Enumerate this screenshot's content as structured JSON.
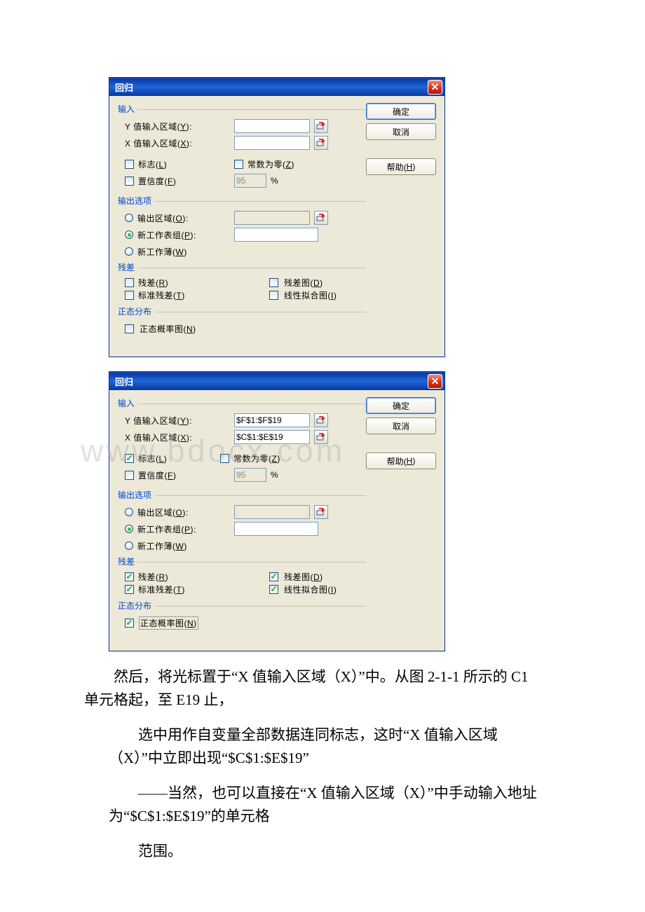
{
  "watermark": "www.bdocx.com",
  "dialogs": [
    {
      "title": "回归",
      "buttons": {
        "ok": "确定",
        "cancel": "取消",
        "help": "帮助(H)",
        "help_accel": "H"
      },
      "input": {
        "legend": "输入",
        "y_label": "Y 值输入区域(Y):",
        "y_accel": "Y",
        "y_value": "",
        "x_label": "X 值输入区域(X):",
        "x_accel": "X",
        "x_value": "",
        "labels_cb": "标志(L)",
        "labels_accel": "L",
        "labels_checked": false,
        "zero_cb": "常数为零(Z)",
        "zero_accel": "Z",
        "zero_checked": false,
        "conf_cb": "置信度(F)",
        "conf_accel": "F",
        "conf_checked": false,
        "conf_value": "95",
        "pct": "%"
      },
      "output": {
        "legend": "输出选项",
        "out_range": "输出区域(O):",
        "out_accel": "O",
        "out_selected": false,
        "out_value": "",
        "new_sheet": "新工作表组(P):",
        "new_sheet_accel": "P",
        "new_sheet_selected": true,
        "new_sheet_value": "",
        "new_book": "新工作薄(W)",
        "new_book_accel": "W",
        "new_book_selected": false,
        "resid_legend": "残差",
        "resid_cb": "残差(R)",
        "resid_accel": "R",
        "resid_checked": false,
        "residplot_cb": "残差图(D)",
        "residplot_accel": "D",
        "residplot_checked": false,
        "stdresid_cb": "标准残差(T)",
        "stdresid_accel": "T",
        "stdresid_checked": false,
        "linefit_cb": "线性拟合图(I)",
        "linefit_accel": "I",
        "linefit_checked": false,
        "norm_legend": "正态分布",
        "normprob_cb": "正态概率图(N)",
        "normprob_accel": "N",
        "normprob_checked": false
      }
    },
    {
      "title": "回归",
      "buttons": {
        "ok": "确定",
        "cancel": "取消",
        "help": "帮助(H)",
        "help_accel": "H"
      },
      "input": {
        "legend": "输入",
        "y_label": "Y 值输入区域(Y):",
        "y_accel": "Y",
        "y_value": "$F$1:$F$19",
        "x_label": "X 值输入区域(X):",
        "x_accel": "X",
        "x_value": "$C$1:$E$19",
        "labels_cb": "标志(L)",
        "labels_accel": "L",
        "labels_checked": true,
        "zero_cb": "常数为零(Z)",
        "zero_accel": "Z",
        "zero_checked": false,
        "conf_cb": "置信度(F)",
        "conf_accel": "F",
        "conf_checked": false,
        "conf_value": "95",
        "pct": "%"
      },
      "output": {
        "legend": "输出选项",
        "out_range": "输出区域(O):",
        "out_accel": "O",
        "out_selected": false,
        "out_value": "",
        "new_sheet": "新工作表组(P):",
        "new_sheet_accel": "P",
        "new_sheet_selected": true,
        "new_sheet_value": "",
        "new_book": "新工作薄(W)",
        "new_book_accel": "W",
        "new_book_selected": false,
        "resid_legend": "残差",
        "resid_cb": "残差(R)",
        "resid_accel": "R",
        "resid_checked": true,
        "residplot_cb": "残差图(D)",
        "residplot_accel": "D",
        "residplot_checked": true,
        "stdresid_cb": "标准残差(T)",
        "stdresid_accel": "T",
        "stdresid_checked": true,
        "linefit_cb": "线性拟合图(I)",
        "linefit_accel": "I",
        "linefit_checked": true,
        "norm_legend": "正态分布",
        "normprob_cb": "正态概率图(N)",
        "normprob_accel": "N",
        "normprob_checked": true,
        "normprob_focus": true
      }
    }
  ],
  "paragraphs": [
    "然后，将光标置于“X 值输入区域（X）”中。从图 2-1-1 所示的 C1 单元格起，至 E19 止，",
    "选中用作自变量全部数据连同标志，这时“X 值输入区域（X）”中立即出现“$C$1:$E$19”",
    "——当然，也可以直接在“X 值输入区域（X）”中手动输入地址为“$C$1:$E$19”的单元格",
    "范围。"
  ]
}
